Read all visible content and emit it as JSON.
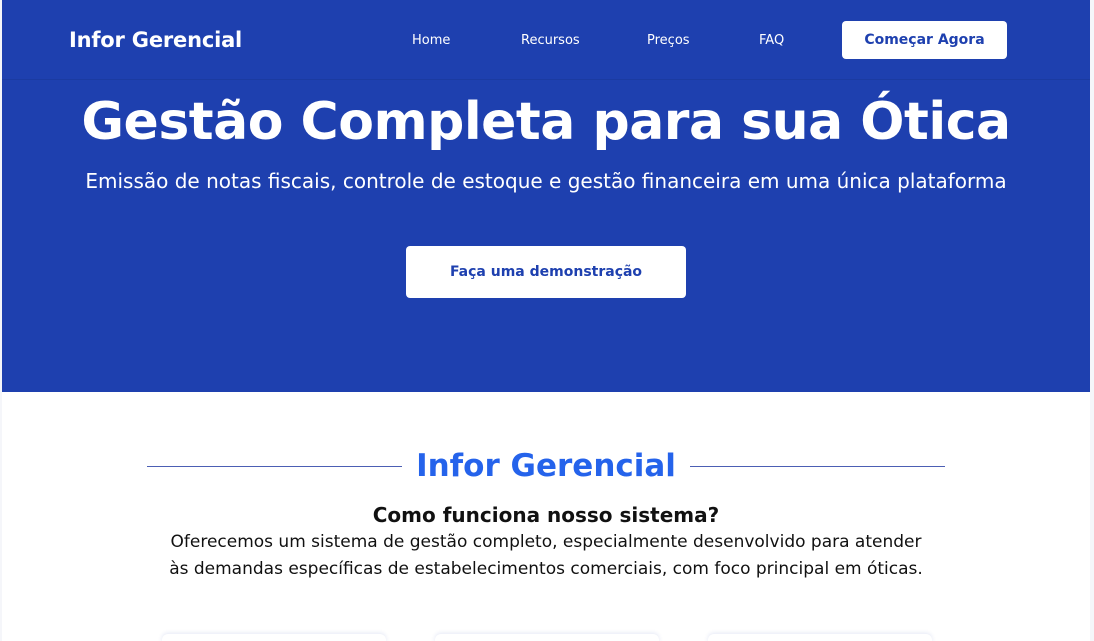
{
  "navbar": {
    "brand": "Infor Gerencial",
    "links": [
      "Home",
      "Recursos",
      "Preços",
      "FAQ"
    ],
    "cta_label": "Começar Agora"
  },
  "hero": {
    "title": "Gestão Completa para sua Ótica",
    "subtitle": "Emissão de notas fiscais, controle de estoque e gestão financeira em uma única plataforma",
    "demo_label": "Faça uma demonstração"
  },
  "about": {
    "title": "Infor Gerencial",
    "question": "Como funciona nosso sistema?",
    "text": "Oferecemos um sistema de gestão completo, especialmente desenvolvido para atender às demandas específicas de estabelecimentos comerciais, com foco principal em óticas."
  },
  "colors": {
    "primary": "#1e40af",
    "accent": "#2563eb",
    "background": "#ffffff"
  }
}
